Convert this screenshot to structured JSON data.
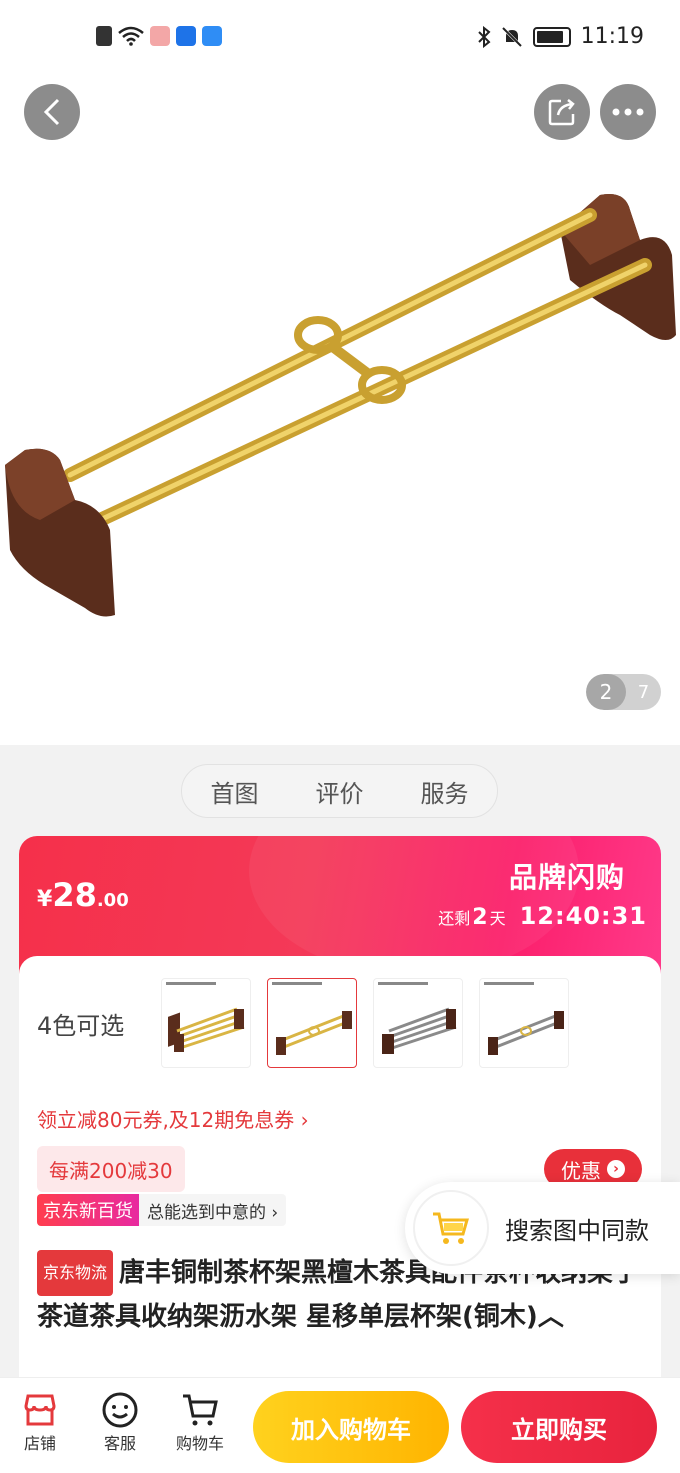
{
  "status_bar": {
    "time": "11:19"
  },
  "gallery": {
    "current": "2",
    "total": "7"
  },
  "tabs": [
    "首图",
    "评价",
    "服务"
  ],
  "flash_sale": {
    "currency": "¥",
    "price_int": "28",
    "price_dec": ".00",
    "title": "品牌闪购",
    "remain_prefix": "还剩",
    "days": "2",
    "days_unit": "天",
    "time": "12:40:31"
  },
  "colors": {
    "label": "4色可选",
    "selected_index": 1,
    "count": 4
  },
  "coupon_line": "领立减80元券,及12期免息券 ›",
  "promo_tag": "每满200减30",
  "youhui_label": "优惠",
  "jd_new": {
    "badge": "京东新百货",
    "text": "总能选到中意的 ›"
  },
  "product": {
    "logistics_badge": "京东物流",
    "title": "唐丰铜制茶杯架黑檀木茶具配件茶杯收纳架子茶道茶具收纳架沥水架 星移单层杯架(铜木)︿"
  },
  "search_same_label": "搜索图中同款",
  "bottom_nav": {
    "shop": "店铺",
    "service": "客服",
    "cart": "购物车",
    "add_cart": "加入购物车",
    "buy_now": "立即购买"
  },
  "colors_accent": {
    "red": "#e4393c",
    "yellow": "#ffc20e",
    "gold": "#d4a92c",
    "wood": "#5a2d1c"
  }
}
